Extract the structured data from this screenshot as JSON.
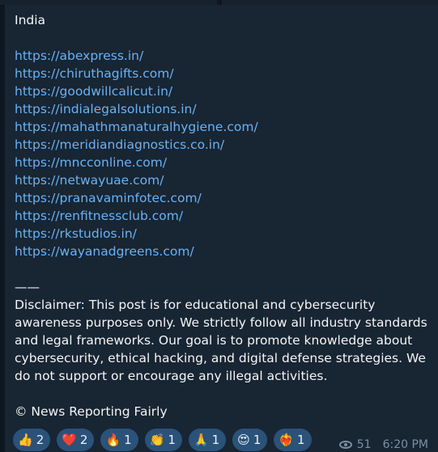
{
  "message": {
    "title": "India",
    "links": [
      "https://abexpress.in/",
      "https://chiruthagifts.com/",
      "https://goodwillcalicut.in/",
      "https://indialegalsolutions.in/",
      "https://mahathmanaturalhygiene.com/",
      "https://meridiandiagnostics.co.in/",
      "https://mncconline.com/",
      "https://netwayuae.com/",
      "https://pranavaminfotec.com/",
      "https://renfitnessclub.com/",
      "https://rkstudios.in/",
      "https://wayanadgreens.com/"
    ],
    "separator": "——",
    "disclaimer": "Disclaimer: This post is for educational and cybersecurity awareness purposes only. We strictly follow all industry standards and legal frameworks. Our goal is to promote knowledge about cybersecurity, ethical hacking, and digital defense strategies. We do not support or encourage any illegal activities.",
    "signature": "© News Reporting Fairly"
  },
  "reactions": [
    {
      "emoji": "👍",
      "count": "2"
    },
    {
      "emoji": "❤️",
      "count": "2"
    },
    {
      "emoji": "🔥",
      "count": "1"
    },
    {
      "emoji": "👏",
      "count": "1"
    },
    {
      "emoji": "🙏",
      "count": "1"
    },
    {
      "emoji": "😍",
      "count": "1"
    },
    {
      "emoji": "❤️‍🔥",
      "count": "1"
    }
  ],
  "meta": {
    "views": "51",
    "time": "6:20 PM",
    "views_icon": "eye-icon"
  },
  "colors": {
    "background": "#0e1621",
    "bubble": "#182533",
    "link": "#6ab2f2",
    "reaction_pill": "#2b5278"
  }
}
